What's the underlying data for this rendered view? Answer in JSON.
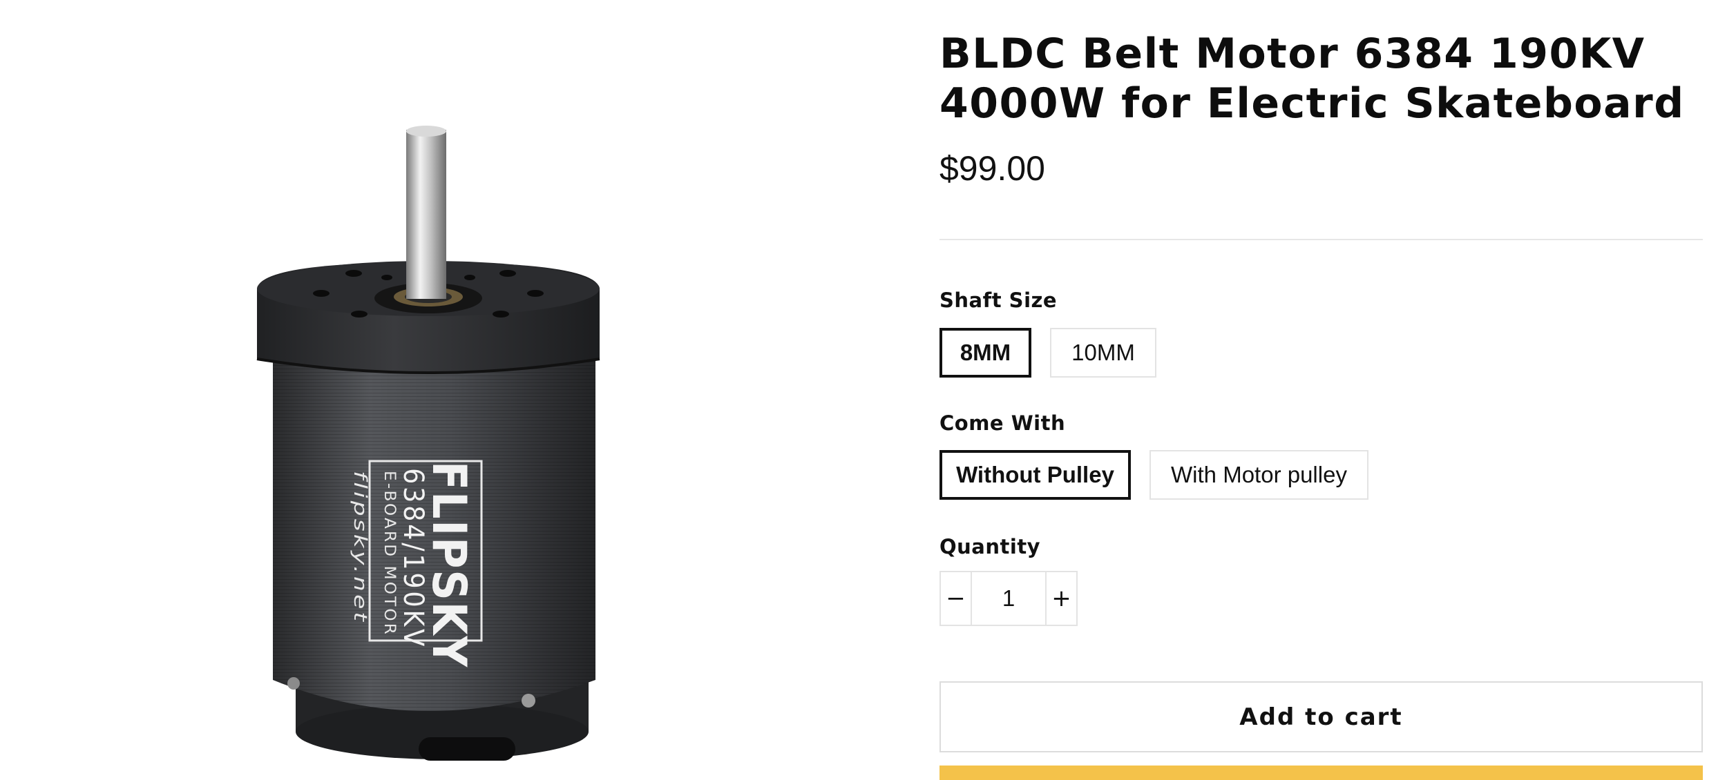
{
  "product": {
    "title": "BLDC Belt Motor 6384 190KV 4000W for Electric Skateboard",
    "price": "$99.00"
  },
  "image": {
    "brand": "FLIPSKY",
    "model": "6384/190KV",
    "subtitle": "E-BOARD MOTOR",
    "site": "flipsky.net"
  },
  "options": {
    "shaft_size": {
      "label": "Shaft Size",
      "values": [
        "8MM",
        "10MM"
      ],
      "selected": "8MM"
    },
    "come_with": {
      "label": "Come With",
      "values": [
        "Without Pulley",
        "With Motor pulley"
      ],
      "selected": "Without Pulley"
    }
  },
  "quantity": {
    "label": "Quantity",
    "value": "1",
    "minus": "−",
    "plus": "+"
  },
  "actions": {
    "add_to_cart": "Add to cart"
  },
  "colors": {
    "buy_button": "#f4c24a",
    "selected_border": "#111111"
  }
}
